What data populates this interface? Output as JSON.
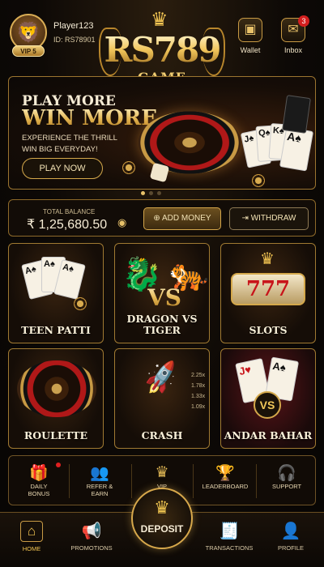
{
  "header": {
    "player_name": "Player123",
    "player_id": "ID: RS78901",
    "vip_label": "VIP 5",
    "logo_main": "RS789",
    "logo_sub": "GAME",
    "wallet_label": "Wallet",
    "inbox_label": "Inbox",
    "inbox_count": "3"
  },
  "banner": {
    "line1": "PLAY MORE",
    "line2": "WIN MORE",
    "sub1": "EXPERIENCE THE THRILL",
    "sub2": "WIN BIG EVERYDAY!",
    "cta": "PLAY NOW",
    "slides": 3,
    "active_slide": 0
  },
  "balance": {
    "label": "TOTAL BALANCE",
    "amount": "₹ 1,25,680.50",
    "add_money": "ADD MONEY",
    "withdraw": "WITHDRAW"
  },
  "games": [
    {
      "title": "TEEN PATTI"
    },
    {
      "title": "DRAGON VS TIGER"
    },
    {
      "title": "SLOTS"
    },
    {
      "title": "ROULETTE"
    },
    {
      "title": "CRASH"
    },
    {
      "title": "ANDAR BAHAR"
    }
  ],
  "crash_multipliers": [
    "2.25x",
    "1.78x",
    "1.33x",
    "1.09x"
  ],
  "quick_menu": {
    "daily_bonus": "DAILY BONUS",
    "refer": "REFER & EARN",
    "vip_club": "VIP CLUB",
    "leaderboard": "LEADERBOARD",
    "support": "SUPPORT"
  },
  "bottom_nav": {
    "home": "HOME",
    "promotions": "PROMOTIONS",
    "deposit": "DEPOSIT",
    "transactions": "TRANSACTIONS",
    "profile": "PROFILE"
  },
  "colors": {
    "accent": "#e8c26a",
    "background": "#0b0806",
    "badge": "#d41f1f"
  }
}
